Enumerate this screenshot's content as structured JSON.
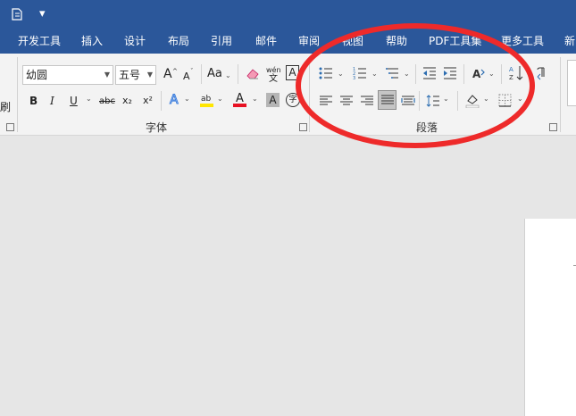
{
  "quick_access": {
    "doc_icon": "document-icon",
    "dropdown_glyph": "▾"
  },
  "tabs": [
    {
      "label": "开发工具"
    },
    {
      "label": "插入"
    },
    {
      "label": "设计"
    },
    {
      "label": "布局"
    },
    {
      "label": "引用"
    },
    {
      "label": "邮件"
    },
    {
      "label": "审阅"
    },
    {
      "label": "视图"
    },
    {
      "label": "帮助"
    },
    {
      "label": "PDF工具集"
    },
    {
      "label": "更多工具"
    },
    {
      "label": "新"
    }
  ],
  "font_group": {
    "font_name": "幼圆",
    "font_size": "五号",
    "label": "字体",
    "case_label": "Aa",
    "bold": "B",
    "italic": "I",
    "underline": "U",
    "strike": "abc",
    "subscript": "x₂",
    "superscript": "x²",
    "grow": "A",
    "shrink": "A",
    "phonetic_top": "wén",
    "phonetic_bottom": "文",
    "char_border": "A",
    "char_shading": "A",
    "enclose": "字",
    "text_effect": "A",
    "highlight_text": "ab",
    "font_color_letter": "A"
  },
  "paragraph_group": {
    "label": "段落"
  },
  "left_stub_label": "刷",
  "colors": {
    "ribbon_blue": "#2b579a",
    "annotation_red": "#ee2a2a",
    "highlight_yellow": "#ffe600",
    "font_red": "#e81123"
  }
}
